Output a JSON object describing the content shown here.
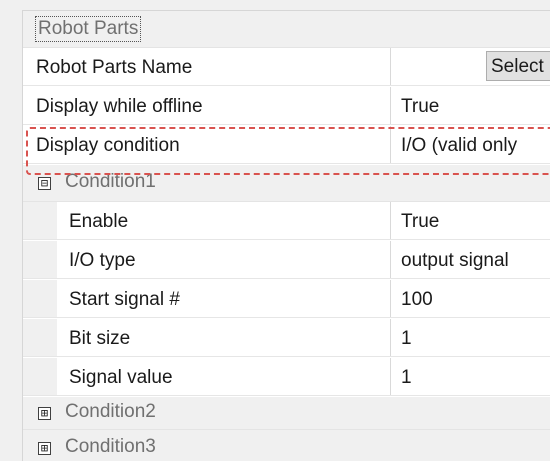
{
  "grid": {
    "root_category": "Robot Parts",
    "top_properties": [
      {
        "name": "Robot Parts Name",
        "value": "Select"
      },
      {
        "name": "Display while offline",
        "value": "True"
      },
      {
        "name": "Display condition",
        "value": "I/O (valid only"
      }
    ],
    "condition1": {
      "label": "Condition1",
      "expander": "⊟",
      "properties": [
        {
          "name": "Enable",
          "value": "True"
        },
        {
          "name": "I/O type",
          "value": "output signal"
        },
        {
          "name": "Start signal #",
          "value": "100"
        },
        {
          "name": "Bit size",
          "value": "1"
        },
        {
          "name": "Signal value",
          "value": "1"
        }
      ]
    },
    "condition2": {
      "label": "Condition2",
      "expander": "⊞"
    },
    "condition3": {
      "label": "Condition3",
      "expander": "⊞"
    }
  },
  "colors": {
    "highlight": "#d9534f",
    "category_background": "#f0f0f0"
  }
}
